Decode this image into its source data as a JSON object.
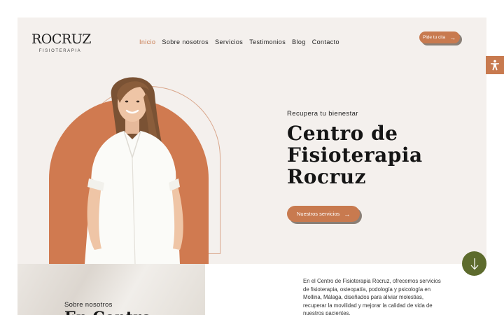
{
  "logo": {
    "main": "ROCRUZ",
    "sub": "FISIOTERAPIA"
  },
  "nav": {
    "items": [
      {
        "label": "Inicio",
        "active": true
      },
      {
        "label": "Sobre nosotros"
      },
      {
        "label": "Servicios"
      },
      {
        "label": "Testimonios"
      },
      {
        "label": "Blog"
      },
      {
        "label": "Contacto"
      }
    ]
  },
  "header": {
    "cta_label": "Pide tu cita",
    "cta_icon": "arrow-right-icon"
  },
  "hero": {
    "tagline": "Recupera tu bienestar",
    "title_lines": [
      "Centro de",
      "Fisioterapia",
      "Rocruz"
    ],
    "button_label": "Nuestros servicios",
    "button_icon": "arrow-right-icon"
  },
  "about": {
    "kicker": "Sobre nosotros",
    "heading": "En Centro",
    "text": "En el Centro de Fisioterapia Rocruz, ofrecemos servicios de fisioterapia, osteopatía, podología y psicología en Mollina, Málaga, diseñados para aliviar molestias, recuperar la movilidad y mejorar la calidad de vida de nuestros pacientes."
  },
  "widgets": {
    "accessibility_icon": "accessibility-icon",
    "scroll_icon": "arrow-down-icon"
  },
  "colors": {
    "accent": "#c87a4f",
    "arch": "#d07a50",
    "hero_bg": "#f4f0ed",
    "scroll_button": "#5d6b2d"
  }
}
